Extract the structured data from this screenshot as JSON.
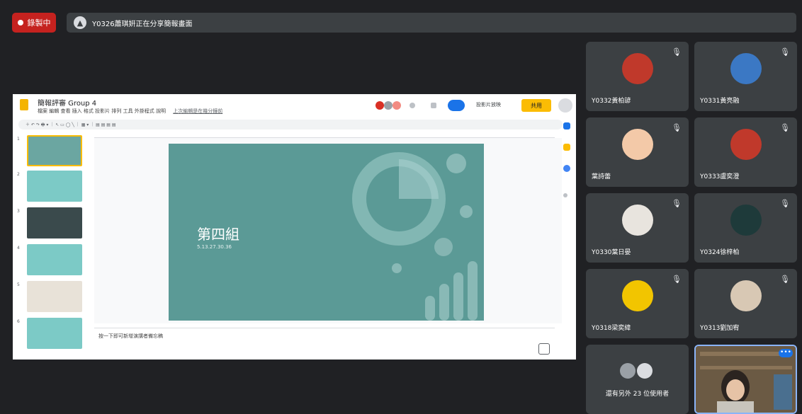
{
  "top_bar": {
    "recording_label": "錄製中",
    "share_banner_text": "Y0326蕭琪姸正在分享簡報畫面"
  },
  "presentation": {
    "doc_title": "簡報評審 Group 4",
    "menus": "檔案 編輯 查看 插入 格式 投影片 排列 工具 外掛程式 說明",
    "last_edit": "上次編輯是在幾分鐘前",
    "slideshow_label": "投影片放映",
    "share_label": "共用",
    "slide_title": "第四組",
    "slide_subtitle": "5.13.27.30.36",
    "notes_placeholder": "按一下即可新增演講者備忘稿",
    "thumbnail_numbers": [
      "1",
      "2",
      "3",
      "4",
      "5",
      "6"
    ],
    "colors": {
      "slide_bg": "#5b9a96",
      "accent_yellow": "#fbbc04",
      "accent_blue": "#1a73e8"
    }
  },
  "participants": [
    {
      "name": "Y0332黃柏諺",
      "muted": true
    },
    {
      "name": "Y0331黃亮融",
      "muted": true
    },
    {
      "name": "葉詩蕾",
      "muted": true
    },
    {
      "name": "Y0333盧奕澄",
      "muted": true
    },
    {
      "name": "Y0330葉日晏",
      "muted": true
    },
    {
      "name": "Y0324徐梓柏",
      "muted": true
    },
    {
      "name": "Y0318梁奕緯",
      "muted": true
    },
    {
      "name": "Y0313劉加宥",
      "muted": true
    }
  ],
  "others_tile": {
    "label": "還有另外 23 位使用者"
  },
  "icons": {
    "mic_off": "mic-off-icon",
    "record": "record-dot-icon",
    "more": "more-options-icon"
  }
}
